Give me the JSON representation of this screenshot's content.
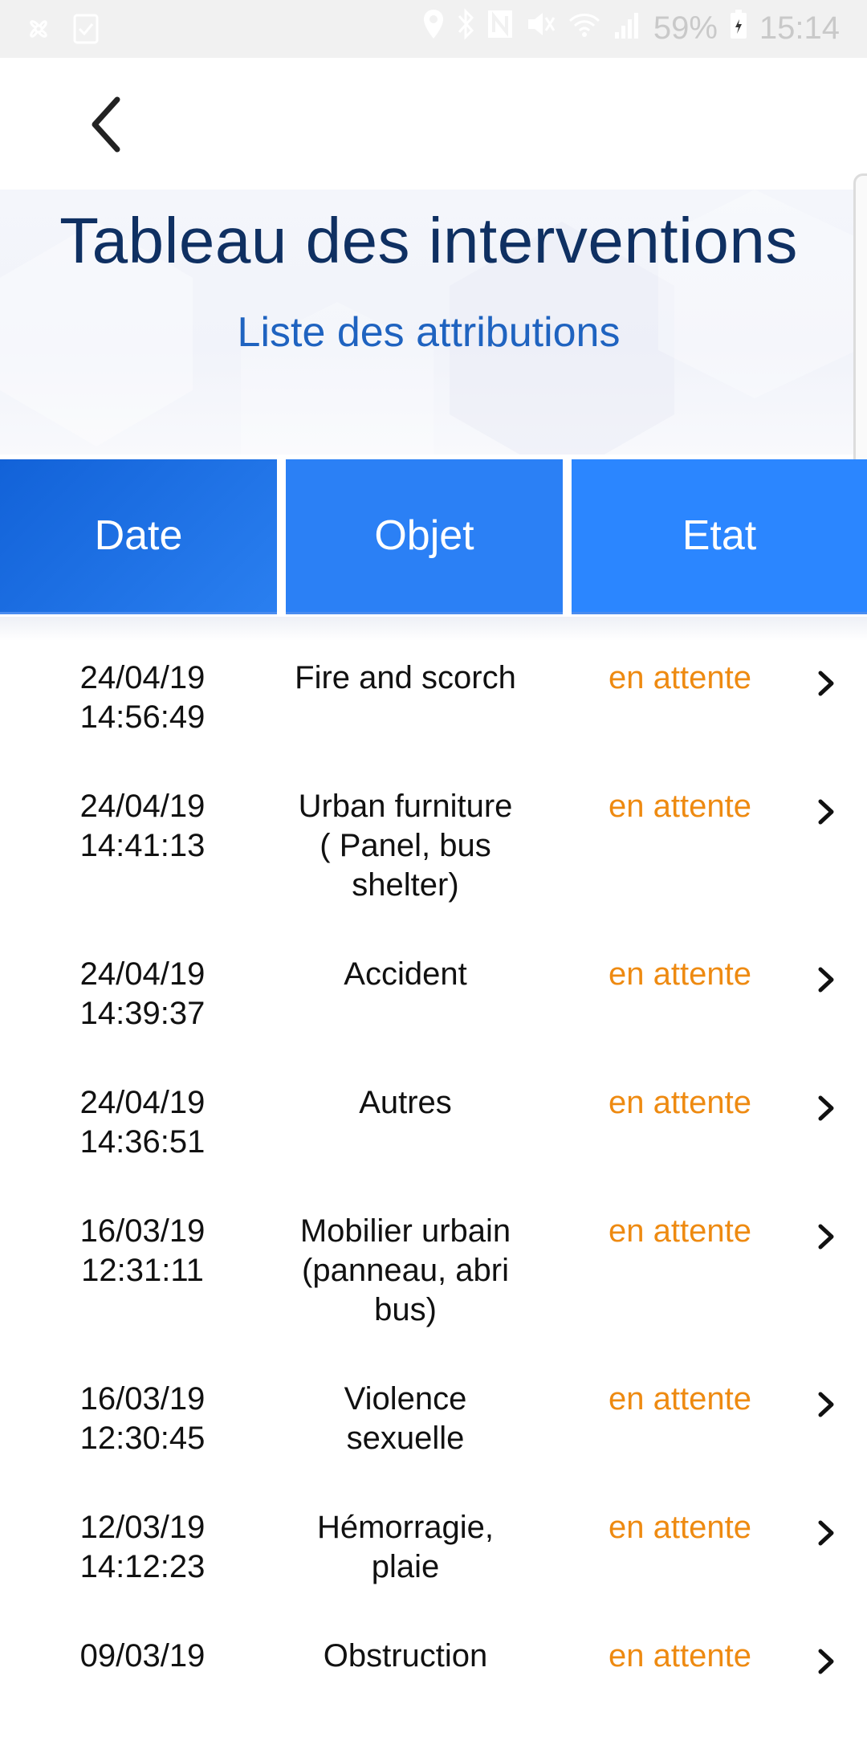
{
  "status_bar": {
    "icons_left": [
      "pinwheel-icon",
      "checkbox-icon"
    ],
    "icons_right": [
      "location-icon",
      "bluetooth-icon",
      "nfc-icon",
      "mute-icon",
      "wifi-icon",
      "signal-icon",
      "battery-icon"
    ],
    "battery_percent": "59%",
    "time": "15:14"
  },
  "toolbar": {
    "back_icon": "chevron-left-icon"
  },
  "header": {
    "title": "Tableau des interventions",
    "subtitle": "Liste des attributions"
  },
  "columns": {
    "date": "Date",
    "objet": "Objet",
    "etat": "Etat"
  },
  "colors": {
    "title": "#0f3062",
    "subtitle": "#1f63c0",
    "header_blue": "#2b80f5",
    "status_pending": "#ee8a11"
  },
  "rows": [
    {
      "date": "24/04/19",
      "time": "14:56:49",
      "objet": [
        "Fire and scorch"
      ],
      "etat": "en attente"
    },
    {
      "date": "24/04/19",
      "time": "14:41:13",
      "objet": [
        "Urban furniture",
        "( Panel, bus",
        "shelter)"
      ],
      "etat": "en attente"
    },
    {
      "date": "24/04/19",
      "time": "14:39:37",
      "objet": [
        "Accident"
      ],
      "etat": "en attente"
    },
    {
      "date": "24/04/19",
      "time": "14:36:51",
      "objet": [
        "Autres"
      ],
      "etat": "en attente"
    },
    {
      "date": "16/03/19",
      "time": "12:31:11",
      "objet": [
        "Mobilier urbain",
        "(panneau, abri",
        "bus)"
      ],
      "etat": "en attente"
    },
    {
      "date": "16/03/19",
      "time": "12:30:45",
      "objet": [
        "Violence",
        "sexuelle"
      ],
      "etat": "en attente"
    },
    {
      "date": "12/03/19",
      "time": "14:12:23",
      "objet": [
        "Hémorragie,",
        "plaie"
      ],
      "etat": "en attente"
    },
    {
      "date": "09/03/19",
      "time": "",
      "objet": [
        "Obstruction"
      ],
      "etat": "en attente"
    }
  ]
}
